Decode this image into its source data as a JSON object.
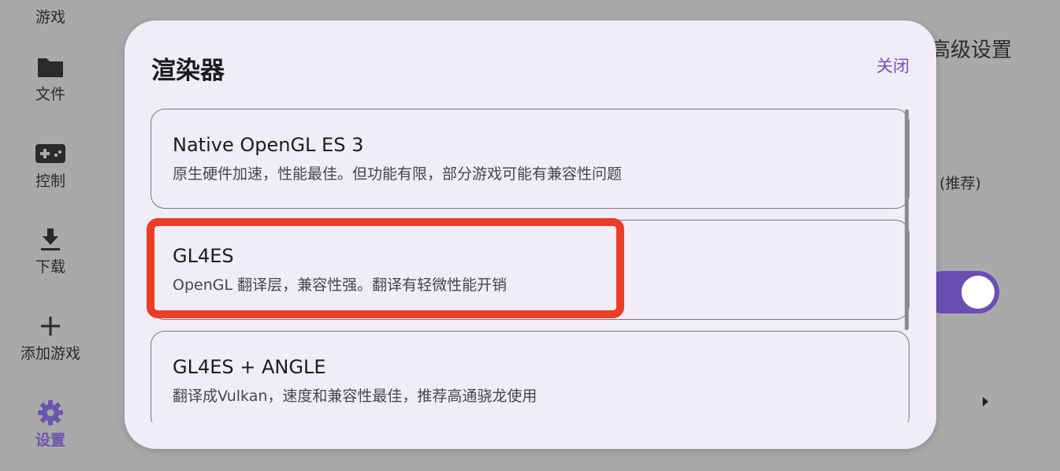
{
  "sidebar": {
    "items": [
      {
        "label": "游戏",
        "icon": "gamepad-icon"
      },
      {
        "label": "文件",
        "icon": "folder-icon"
      },
      {
        "label": "控制",
        "icon": "controller-icon"
      },
      {
        "label": "下载",
        "icon": "download-icon"
      },
      {
        "label": "添加游戏",
        "icon": "plus-icon"
      },
      {
        "label": "设置",
        "icon": "gear-icon"
      }
    ],
    "active_item": "设置"
  },
  "background": {
    "section_title": "高级设置",
    "recommend_note": "(推荐)",
    "toggle_on": true
  },
  "dialog": {
    "title": "渲染器",
    "close_label": "关闭",
    "options": [
      {
        "name": "Native OpenGL ES 3",
        "description": "原生硬件加速，性能最佳。但功能有限，部分游戏可能有兼容性问题"
      },
      {
        "name": "GL4ES",
        "description": "OpenGL 翻译层，兼容性强。翻译有轻微性能开销"
      },
      {
        "name": "GL4ES + ANGLE",
        "description": "翻译成Vulkan，速度和兼容性最佳，推荐高通骁龙使用"
      }
    ]
  },
  "colors": {
    "accent": "#6a55b0",
    "highlight_box": "#ec3d26",
    "dialog_bg": "#f0ecf8",
    "scrim": "#a9a9a9"
  }
}
